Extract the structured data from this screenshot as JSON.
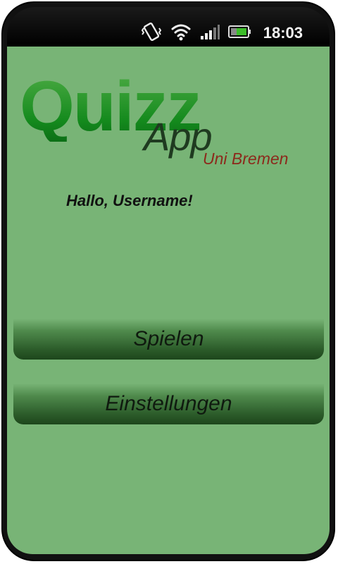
{
  "status_bar": {
    "time": "18:03",
    "icons": [
      "vibrate-icon",
      "wifi-icon",
      "signal-icon",
      "battery-icon"
    ]
  },
  "logo": {
    "title": "Quizz",
    "subtitle": "App",
    "tagline": "Uni Bremen"
  },
  "greeting": "Hallo, Username!",
  "buttons": {
    "play_label": "Spielen",
    "settings_label": "Einstellungen"
  },
  "colors": {
    "screen_background": "#78b476",
    "logo_green": "#1b8e24",
    "tagline_red": "#8c2a1c",
    "button_dark": "#1d461c"
  }
}
